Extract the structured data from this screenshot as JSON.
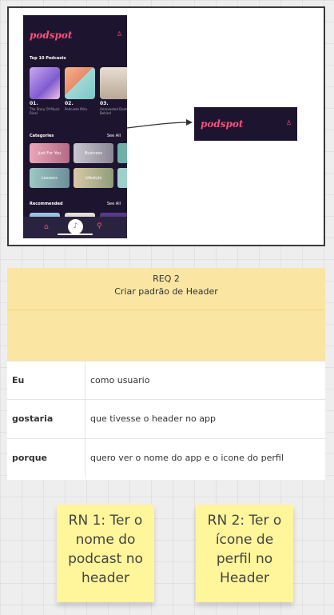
{
  "phone": {
    "logo": "podspot",
    "user_glyph": "♙",
    "top_section": "Top 10 Podcasts",
    "podcasts": [
      {
        "num": "01.",
        "title": "The Story Of Music Rival"
      },
      {
        "num": "02.",
        "title": "Podcaste Mira"
      },
      {
        "num": "03.",
        "title": "Unrevealed Destiny Behind"
      }
    ],
    "categories_section": "Categories",
    "see_all": "See All",
    "categories": [
      "Just For You",
      "Business",
      "Lessons",
      "Lifestyle"
    ],
    "recommended_section": "Recommended",
    "tab_home": "⌂",
    "tab_mic": "♪",
    "tab_search": "⚲"
  },
  "header_preview": {
    "logo": "podspot",
    "user_glyph": "♙"
  },
  "req": {
    "title": "REQ 2",
    "subtitle": "Criar padrão de Header",
    "rows": [
      {
        "label": "Eu",
        "value": "como usuario"
      },
      {
        "label": "gostaria",
        "value": "que tivesse o header no app"
      },
      {
        "label": "porque",
        "value": "quero ver o nome do app e o icone do perfil"
      }
    ]
  },
  "rules": [
    {
      "line1": "RN 1: Ter o",
      "line2": "nome do",
      "line3": "podcast no",
      "line4": "header"
    },
    {
      "line1": "RN 2: Ter o",
      "line2": "ícone de",
      "line3": "perfil no",
      "line4": "Header"
    }
  ],
  "colors": {
    "brand": "#ff4f7a",
    "app_bg": "#1d1530",
    "req_header": "#fae6a2",
    "sticky": "#fff59a"
  }
}
